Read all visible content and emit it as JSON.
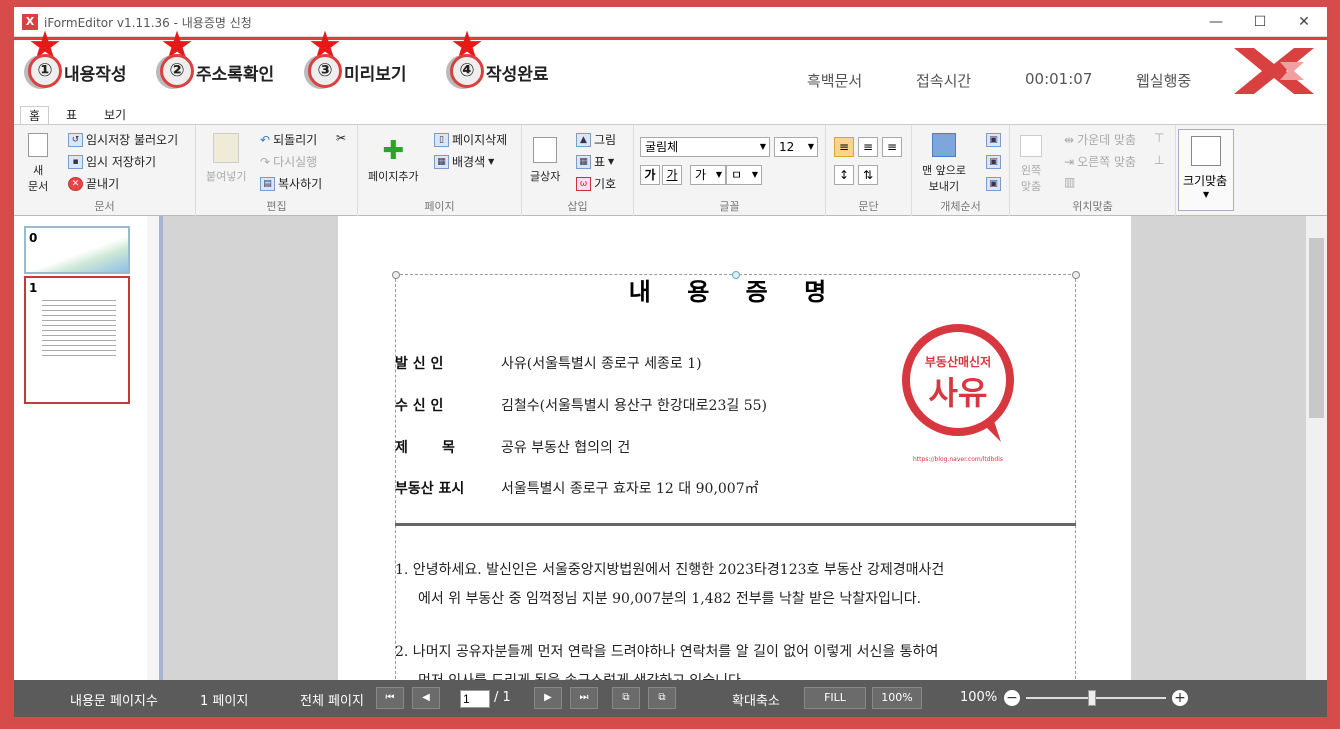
{
  "window": {
    "title": "iFormEditor v1.11.36 - 내용증명 신청",
    "minimize": "—",
    "maximize": "☐",
    "close": "✕",
    "app_icon": "X"
  },
  "steps": [
    {
      "num": "①",
      "label": "내용작성"
    },
    {
      "num": "②",
      "label": "주소록확인"
    },
    {
      "num": "③",
      "label": "미리보기"
    },
    {
      "num": "④",
      "label": "작성완료"
    }
  ],
  "header": {
    "doc_type": "흑백문서",
    "time_label": "접속시간",
    "time_value": "00:01:07",
    "status": "웹실행중"
  },
  "ribbon_tabs": [
    "홈",
    "표",
    "보기"
  ],
  "ribbon": {
    "doc": {
      "new": "새\n문서",
      "load_temp": "임시저장 불러오기",
      "save_temp": "임시 저장하기",
      "exit": "끝내기",
      "group": "문서"
    },
    "edit": {
      "paste": "붙여넣기",
      "undo": "되돌리기",
      "redo": "다시실행",
      "copy": "복사하기",
      "group": "편집"
    },
    "page": {
      "add": "페이지추가",
      "delete": "페이지삭제",
      "bg": "배경색",
      "group": "페이지"
    },
    "insert": {
      "textbox": "글상자",
      "image": "그림",
      "table": "표",
      "symbol": "기호",
      "group": "삽입"
    },
    "font": {
      "family": "굴림체",
      "size": "12",
      "bold": "가",
      "italic": "가",
      "group": "글꼴",
      "color1": "가",
      "color2": "ㅁ"
    },
    "para": {
      "group": "문단"
    },
    "order": {
      "front": "맨 앞으로\n보내기",
      "group": "개체순서"
    },
    "align": {
      "left": "왼쪽\n맞춤",
      "center": "가운데 맞춤",
      "right": "오른쪽 맞춤",
      "group": "위치맞춤"
    },
    "fit": {
      "label": "크기맞춤"
    }
  },
  "thumbnails": [
    "0",
    "1"
  ],
  "document": {
    "title": "내 용 증 명",
    "fields": [
      {
        "label": "발 신 인",
        "value": "사유(서울특별시 종로구 세종로 1)"
      },
      {
        "label": "수 신 인",
        "value": "김철수(서울특별시 용산구 한강대로23길 55)"
      },
      {
        "label": "제       목",
        "value": "공유 부동산 협의의 건"
      },
      {
        "label": "부동산 표시",
        "value": "서울특별시 종로구 효자로 12   대   90,007㎡"
      }
    ],
    "paragraphs": [
      {
        "line1": "1.  안녕하세요. 발신인은 서울중앙지방법원에서 진행한 2023타경123호 부동산 강제경매사건",
        "line2": "에서 위 부동산 중 임꺽정님 지분 90,007분의 1,482 전부를 낙찰 받은 낙찰자입니다."
      },
      {
        "line1": "2.  나머지 공유자분들께 먼저 연락을 드려야하나 연락처를 알 길이 없어 이렇게 서신을 통하여",
        "line2": "먼저 인사를 드리게 됨을 송구스럽게 생각하고 있습니다."
      }
    ],
    "seal": {
      "top": "부동산매신저",
      "main": "사유",
      "url": "https://blog.naver.com/ltdbdis"
    }
  },
  "status": {
    "pages_label": "내용문 페이지수",
    "pages_value": "1 페이지",
    "total_label": "전체 페이지",
    "current_page": "1",
    "total_pages": "/ 1",
    "zoom_label": "확대축소",
    "fill": "FILL",
    "zoom_btn": "100%",
    "zoom_value": "100%"
  },
  "colors": {
    "accent": "#d94141",
    "statusbar": "#5b5b5b"
  }
}
